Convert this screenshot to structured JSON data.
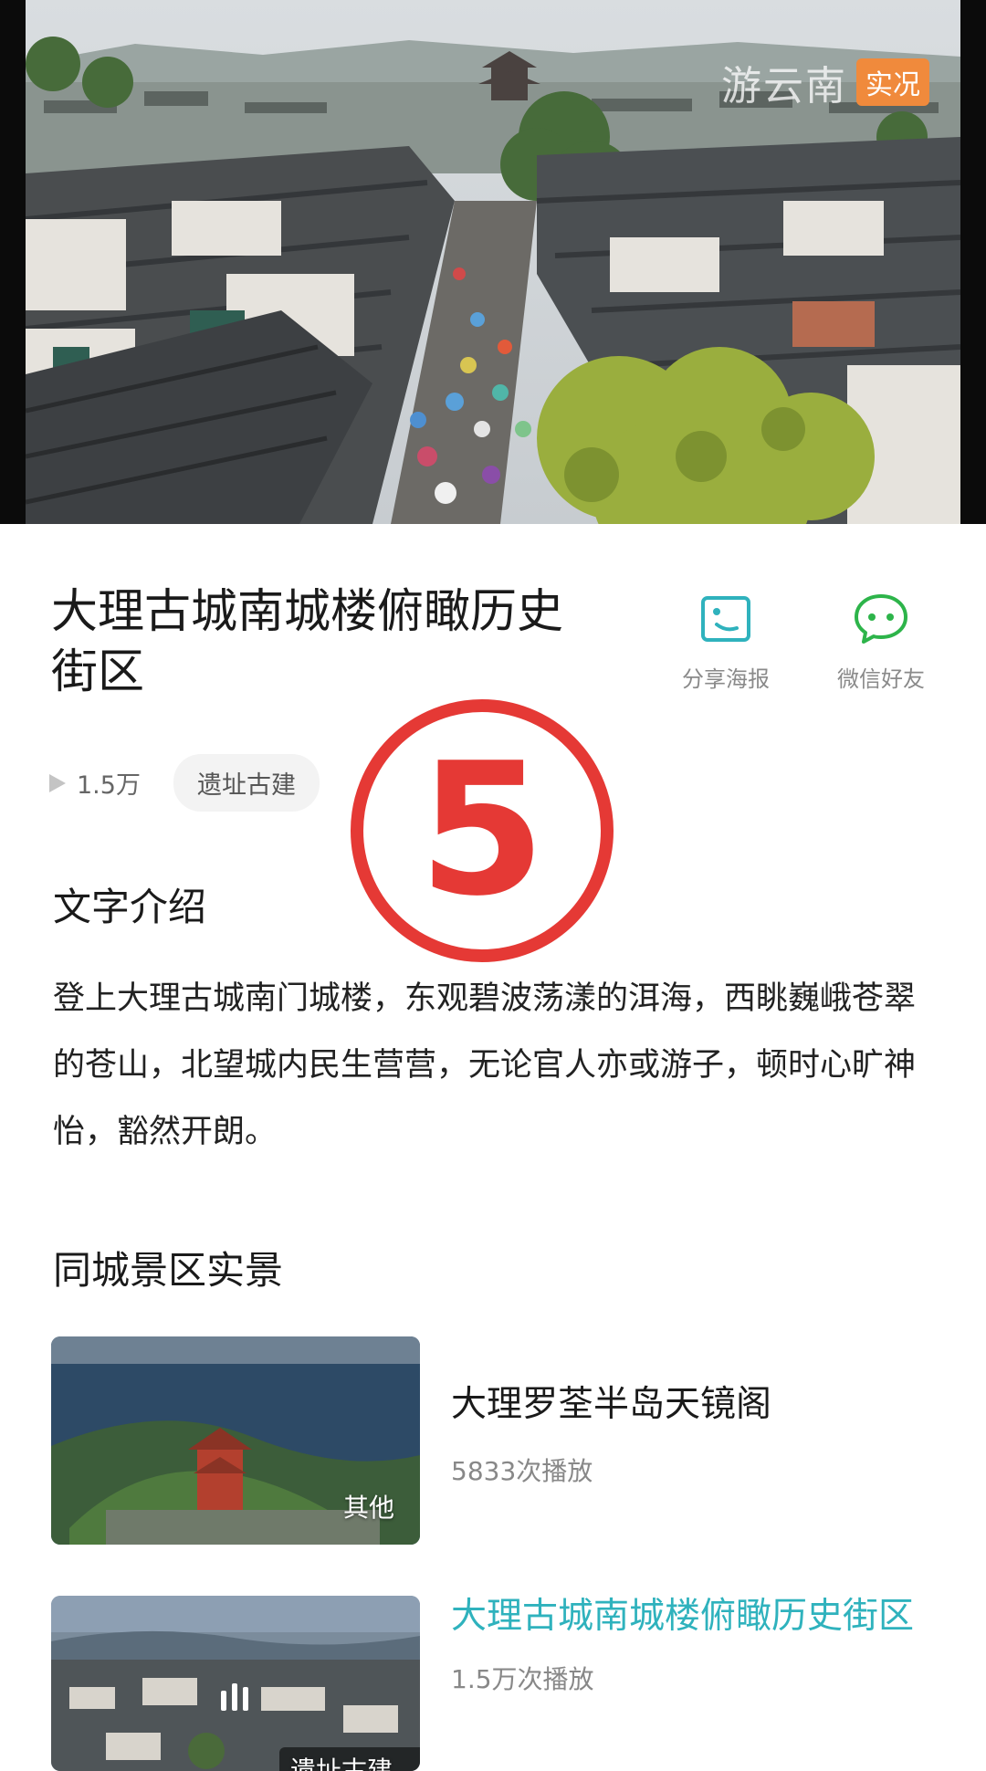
{
  "video": {
    "watermark_text": "游云南",
    "watermark_badge": "实况"
  },
  "spot": {
    "title": "大理古城南城楼俯瞰历史街区",
    "play_count": "1.5万",
    "tag": "遗址古建"
  },
  "actions": {
    "share_poster": "分享海报",
    "wechat_friends": "微信好友",
    "share_icon": "poster-image-icon",
    "wechat_icon": "wechat-icon"
  },
  "stamp": {
    "number": "5",
    "color": "#e53935"
  },
  "intro": {
    "title": "文字介绍",
    "body": "登上大理古城南门城楼，东观碧波荡漾的洱海，西眺巍峨苍翠的苍山，北望城内民生营营，无论官人亦或游子，顿时心旷神怡，豁然开朗。"
  },
  "same_city": {
    "title": "同城景区实景",
    "items": [
      {
        "name": "大理罗荃半岛天镜阁",
        "plays": "5833次播放",
        "tag": "其他"
      },
      {
        "name": "大理古城南城楼俯瞰历史街区",
        "plays": "1.5万次播放",
        "tag": "遗址古建",
        "playing": true
      }
    ]
  },
  "colors": {
    "accent": "#2fb2bd",
    "badge": "#f08a3c",
    "text": "#1a1a1a",
    "muted": "#888888"
  }
}
